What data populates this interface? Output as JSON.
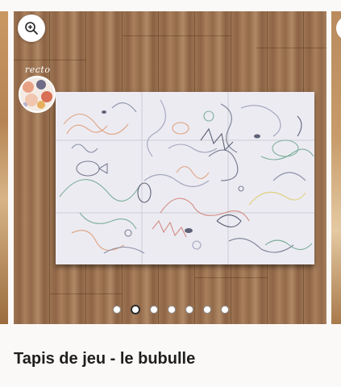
{
  "gallery": {
    "badge_word": "recto",
    "dot_count": 7,
    "active_index": 1,
    "zoom_icon": "zoom-in-icon"
  },
  "product": {
    "title": "Tapis de jeu - le bubulle"
  },
  "colors": {
    "background": "#fbf9f7",
    "title": "#1f1f1f",
    "dot_active_border": "#2a2a2a"
  }
}
